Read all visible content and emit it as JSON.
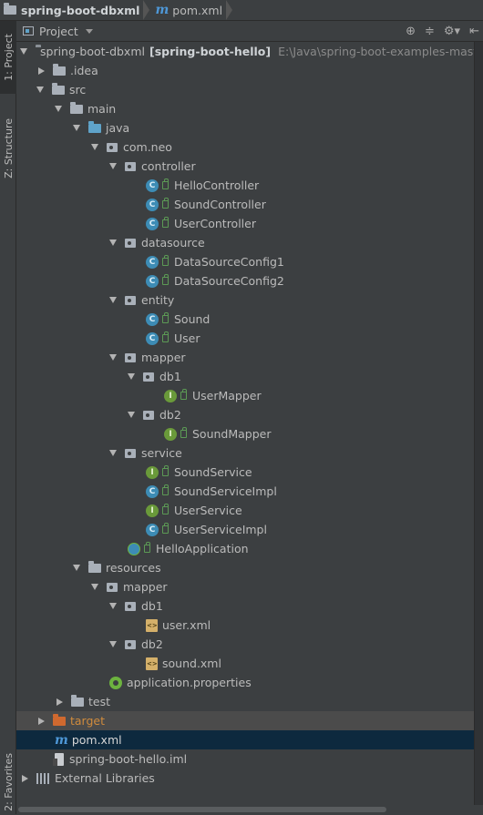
{
  "breadcrumb": {
    "project": "spring-boot-dbxml",
    "file": "pom.xml"
  },
  "tool_strip": {
    "project_tab": "1: Project",
    "structure_tab": "Z: Structure",
    "favorites_tab": "2: Favorites"
  },
  "panel": {
    "view_label": "Project"
  },
  "tree": {
    "root_label": "spring-boot-dbxml",
    "root_module": "[spring-boot-hello]",
    "root_path": "E:\\Java\\spring-boot-examples-master",
    "idea": ".idea",
    "src": "src",
    "main": "main",
    "java": "java",
    "com_neo": "com.neo",
    "controller": "controller",
    "hello_controller": "HelloController",
    "sound_controller": "SoundController",
    "user_controller": "UserController",
    "datasource": "datasource",
    "ds_config1": "DataSourceConfig1",
    "ds_config2": "DataSourceConfig2",
    "entity": "entity",
    "sound": "Sound",
    "user": "User",
    "mapper": "mapper",
    "db1": "db1",
    "user_mapper": "UserMapper",
    "db2": "db2",
    "sound_mapper": "SoundMapper",
    "service": "service",
    "sound_service": "SoundService",
    "sound_service_impl": "SoundServiceImpl",
    "user_service": "UserService",
    "user_service_impl": "UserServiceImpl",
    "hello_application": "HelloApplication",
    "resources": "resources",
    "res_mapper": "mapper",
    "res_db1": "db1",
    "user_xml": "user.xml",
    "res_db2": "db2",
    "sound_xml": "sound.xml",
    "application_properties": "application.properties",
    "test": "test",
    "target": "target",
    "pom_xml": "pom.xml",
    "iml": "spring-boot-hello.iml",
    "external_libraries": "External Libraries"
  },
  "icons": {
    "class_letter": "C",
    "interface_letter": "I"
  },
  "colors": {
    "selected_row": "#0d293e",
    "background": "#3c3f41",
    "target_text": "#d08b3d"
  }
}
